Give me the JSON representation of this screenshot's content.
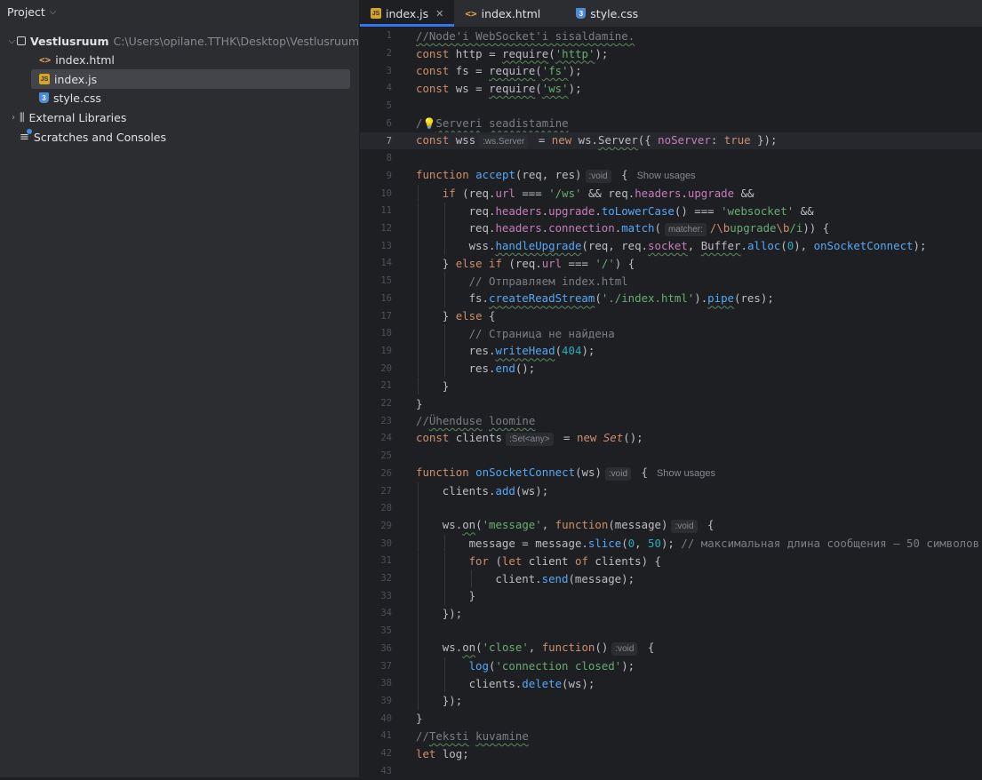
{
  "project_panel": {
    "title": "Project",
    "root_name": "Vestlusruum",
    "root_path": "C:\\Users\\opilane.TTHK\\Desktop\\Vestlusruum",
    "files": [
      "index.html",
      "index.js",
      "style.css"
    ],
    "external_libraries": "External Libraries",
    "scratches": "Scratches and Consoles"
  },
  "tabs": [
    {
      "label": "index.js",
      "active": true
    },
    {
      "label": "index.html",
      "active": false
    },
    {
      "label": "style.css",
      "active": false
    }
  ],
  "current_line": 7,
  "editor": {
    "line_numbers": [
      "1",
      "2",
      "3",
      "4",
      "5",
      "6",
      "7",
      "8",
      "9",
      "10",
      "11",
      "12",
      "13",
      "14",
      "15",
      "16",
      "17",
      "18",
      "19",
      "20",
      "21",
      "22",
      "23",
      "24",
      "25",
      "26",
      "27",
      "28",
      "29",
      "30",
      "31",
      "32",
      "33",
      "34",
      "35",
      "36",
      "37",
      "38",
      "39",
      "40",
      "41",
      "42",
      "43"
    ],
    "code": {
      "l1": "//Node'i WebSocket'i sisaldamine.",
      "l2a": "const",
      "l2b": " http = ",
      "l2c": "require",
      "l2d": "(",
      "l2e": "'http'",
      "l2f": ");",
      "l3a": "const",
      "l3b": " fs = ",
      "l3c": "require",
      "l3d": "(",
      "l3e": "'fs'",
      "l3f": ");",
      "l4a": "const",
      "l4b": " ws = ",
      "l4c": "require",
      "l4d": "(",
      "l4e": "'ws'",
      "l4f": ");",
      "l6a": "/",
      "l6b": "Serveri",
      "l6c": " ",
      "l6d": "seadistamine",
      "l7a": "const",
      "l7b": " wss",
      "l7hint": ":ws.Server",
      "l7c": " = ",
      "l7d": "new",
      "l7e": " ws.",
      "l7f": "Server",
      "l7g": "({ ",
      "l7h": "noServer",
      "l7i": ": ",
      "l7j": "true",
      "l7k": " });",
      "l9a": "function",
      "l9b": " ",
      "l9c": "accept",
      "l9d": "(req, res)",
      "l9hint": ":void",
      "l9e": " {",
      "l9usage": "Show usages",
      "l10a": "if",
      "l10b": " (req.",
      "l10c": "url",
      "l10d": " === ",
      "l10e": "'/ws'",
      "l10f": " && req.",
      "l10g": "headers",
      "l10h": ".",
      "l10i": "upgrade",
      "l10j": " &&",
      "l11a": "req.",
      "l11b": "headers",
      "l11c": ".",
      "l11d": "upgrade",
      "l11e": ".",
      "l11f": "toLowerCase",
      "l11g": "() === ",
      "l11h": "'websocket'",
      "l11i": " &&",
      "l12a": "req.",
      "l12b": "headers",
      "l12c": ".",
      "l12d": "connection",
      "l12e": ".",
      "l12f": "match",
      "l12g": "(",
      "l12hint": "matcher:",
      "l12h": "/\\b",
      "l12i": "upgrade",
      "l12j": "\\b",
      "l12k": "/i",
      "l12l": ")) {",
      "l13a": "wss.",
      "l13b": "handleUpgrade",
      "l13c": "(req, req.",
      "l13d": "socket",
      "l13e": ", ",
      "l13f": "Buffer",
      "l13g": ".",
      "l13h": "alloc",
      "l13i": "(",
      "l13j": "0",
      "l13k": "), ",
      "l13l": "onSocketConnect",
      "l13m": ");",
      "l14a": "} ",
      "l14b": "else if",
      "l14c": " (req.",
      "l14d": "url",
      "l14e": " === ",
      "l14f": "'/'",
      "l14g": ") {",
      "l15": "// Отправляем index.html",
      "l16a": "fs.",
      "l16b": "createReadStream",
      "l16c": "(",
      "l16d": "'./index.html'",
      "l16e": ").",
      "l16f": "pipe",
      "l16g": "(res);",
      "l17a": "} ",
      "l17b": "else",
      "l17c": " {",
      "l18": "// Страница не найдена",
      "l19a": "res.",
      "l19b": "writeHead",
      "l19c": "(",
      "l19d": "404",
      "l19e": ");",
      "l20a": "res.",
      "l20b": "end",
      "l20c": "();",
      "l21": "}",
      "l22": "}",
      "l23a": "//",
      "l23b": "Ühenduse",
      "l23c": " ",
      "l23d": "loomine",
      "l24a": "const",
      "l24b": " clients",
      "l24hint": ":Set<any>",
      "l24c": " = ",
      "l24d": "new",
      "l24e": " ",
      "l24f": "Set",
      "l24g": "();",
      "l26a": "function",
      "l26b": " ",
      "l26c": "onSocketConnect",
      "l26d": "(ws)",
      "l26hint": ":void",
      "l26e": " {",
      "l26usage": "Show usages",
      "l27a": "clients.",
      "l27b": "add",
      "l27c": "(ws);",
      "l29a": "ws.",
      "l29b": "on",
      "l29c": "(",
      "l29d": "'message'",
      "l29e": ", ",
      "l29f": "function",
      "l29g": "(message)",
      "l29hint": ":void",
      "l29h": " {",
      "l30a": "message = message.",
      "l30b": "slice",
      "l30c": "(",
      "l30d": "0",
      "l30e": ", ",
      "l30f": "50",
      "l30g": "); ",
      "l30h": "// максимальная длина сообщения – 50 символов",
      "l31a": "for",
      "l31b": " (",
      "l31c": "let",
      "l31d": " client ",
      "l31e": "of",
      "l31f": " clients) {",
      "l32a": "client.",
      "l32b": "send",
      "l32c": "(message);",
      "l33": "}",
      "l34": "});",
      "l36a": "ws.",
      "l36b": "on",
      "l36c": "(",
      "l36d": "'close'",
      "l36e": ", ",
      "l36f": "function",
      "l36g": "()",
      "l36hint": ":void",
      "l36h": " {",
      "l37a": "log",
      "l37b": "(",
      "l37c": "'connection closed'",
      "l37d": ");",
      "l38a": "clients.",
      "l38b": "delete",
      "l38c": "(ws);",
      "l39": "});",
      "l40": "}",
      "l41a": "//",
      "l41b": "Teksti",
      "l41c": " ",
      "l41d": "kuvamine",
      "l42a": "let",
      "l42b": " log;"
    }
  },
  "colors": {
    "keyword": "#cf8e6d",
    "function": "#56a8f5",
    "string": "#6aab73",
    "number": "#2aacb8",
    "comment": "#7a7e85",
    "property": "#c77dbb",
    "accent": "#3574f0"
  }
}
